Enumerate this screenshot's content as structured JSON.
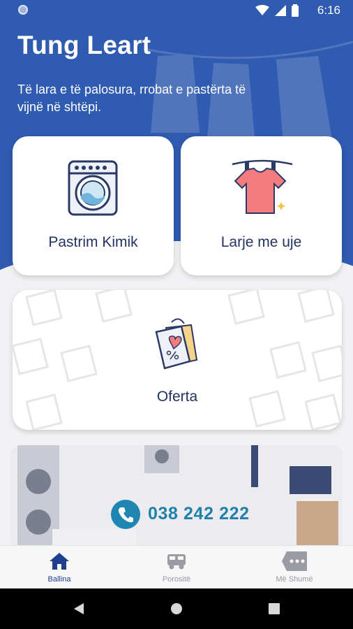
{
  "status_bar": {
    "time": "6:16"
  },
  "header": {
    "title": "Tung Leart",
    "subtitle": "Të lara e të palosura, rrobat e pastërta të vijnë në shtëpi."
  },
  "services": [
    {
      "label": "Pastrim Kimik",
      "icon": "washing-machine-icon"
    },
    {
      "label": "Larje me uje",
      "icon": "tshirt-hanger-icon"
    }
  ],
  "offers": {
    "label": "Oferta",
    "icon": "discount-tag-icon"
  },
  "promo": {
    "phone": "038 242 222",
    "icon": "phone-icon"
  },
  "bottom_nav": [
    {
      "label": "Ballina",
      "icon": "home-icon",
      "active": true
    },
    {
      "label": "Porositë",
      "icon": "delivery-van-icon",
      "active": false
    },
    {
      "label": "Më Shumë",
      "icon": "more-icon",
      "active": false
    }
  ],
  "colors": {
    "primary": "#2f5bb1",
    "card_text": "#23335f",
    "phone_accent": "#1f86b4",
    "nav_active": "#1f3f8f",
    "nav_inactive": "#9a9ba3"
  }
}
